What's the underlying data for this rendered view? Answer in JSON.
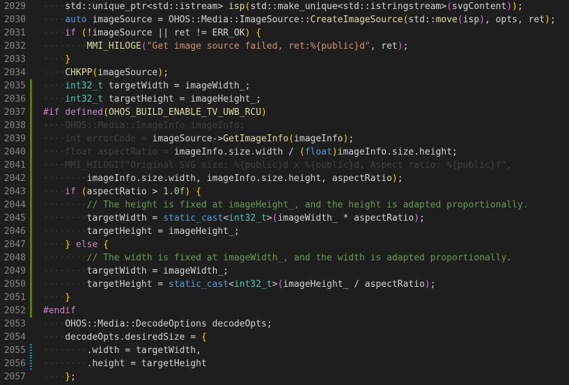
{
  "editor": {
    "lines": [
      {
        "number": "2029",
        "gutter": "",
        "tokens": [
          [
            "····",
            "ws"
          ],
          [
            "std::unique_ptr<std::istream>",
            "plain"
          ],
          [
            " ",
            "ws"
          ],
          [
            "isp",
            "fn"
          ],
          [
            "(",
            "b1"
          ],
          [
            "std::make_unique<std::istringstream>",
            "plain"
          ],
          [
            "(",
            "b2"
          ],
          [
            "svgContent",
            "plain"
          ],
          [
            ")",
            "b2"
          ],
          [
            ")",
            "b1"
          ],
          [
            ";",
            "plain"
          ]
        ]
      },
      {
        "number": "2030",
        "gutter": "",
        "tokens": [
          [
            "····",
            "ws"
          ],
          [
            "auto",
            "kw"
          ],
          [
            " imageSource = OHOS::Media::ImageSource::",
            "plain"
          ],
          [
            "CreateImageSource",
            "fn"
          ],
          [
            "(",
            "b1"
          ],
          [
            "std::",
            "plain"
          ],
          [
            "move",
            "fn"
          ],
          [
            "(",
            "b2"
          ],
          [
            "isp",
            "plain"
          ],
          [
            ")",
            "b2"
          ],
          [
            ", opts, ret",
            "plain"
          ],
          [
            ")",
            "b1"
          ],
          [
            ";",
            "plain"
          ]
        ]
      },
      {
        "number": "2031",
        "gutter": "",
        "tokens": [
          [
            "····",
            "ws"
          ],
          [
            "if",
            "ctl"
          ],
          [
            " ",
            "ws"
          ],
          [
            "(",
            "b1"
          ],
          [
            "!imageSource || ret != ERR_OK",
            "plain"
          ],
          [
            ")",
            "b1"
          ],
          [
            " ",
            "ws"
          ],
          [
            "{",
            "b1"
          ]
        ]
      },
      {
        "number": "2032",
        "gutter": "",
        "tokens": [
          [
            "····",
            "ws"
          ],
          [
            "····",
            "ws"
          ],
          [
            "MMI_HILOGE",
            "macro"
          ],
          [
            "(",
            "b2"
          ],
          [
            "\"Get image source failed, ret:%{public}d\"",
            "str"
          ],
          [
            ", ret",
            "plain"
          ],
          [
            ")",
            "b2"
          ],
          [
            ";",
            "plain"
          ]
        ]
      },
      {
        "number": "2033",
        "gutter": "",
        "tokens": [
          [
            "····",
            "ws"
          ],
          [
            "}",
            "b1"
          ]
        ]
      },
      {
        "number": "2034",
        "gutter": "",
        "tokens": [
          [
            "····",
            "ws"
          ],
          [
            "CHKPP",
            "macro"
          ],
          [
            "(",
            "b1"
          ],
          [
            "imageSource",
            "plain"
          ],
          [
            ")",
            "b1"
          ],
          [
            ";",
            "plain"
          ]
        ]
      },
      {
        "number": "2035",
        "gutter": "added",
        "tokens": [
          [
            "····",
            "ws"
          ],
          [
            "int32_t",
            "type"
          ],
          [
            " targetWidth = imageWidth_;",
            "plain"
          ]
        ]
      },
      {
        "number": "2036",
        "gutter": "added",
        "tokens": [
          [
            "····",
            "ws"
          ],
          [
            "int32_t",
            "type"
          ],
          [
            " targetHeight = imageHeight_;",
            "plain"
          ]
        ]
      },
      {
        "number": "2037",
        "gutter": "added",
        "tokens": [
          [
            "#if",
            "pp"
          ],
          [
            " ",
            "plain"
          ],
          [
            "defined",
            "pp"
          ],
          [
            "(",
            "b1"
          ],
          [
            "OHOS_BUILD_ENABLE_TV_UWB_RCU",
            "macro"
          ],
          [
            ")",
            "b1"
          ]
        ]
      },
      {
        "number": "2038",
        "gutter": "added",
        "tokens": [
          [
            "····OHOS::Media::ImageInfo imageInfo;",
            "guide"
          ]
        ]
      },
      {
        "number": "2039",
        "gutter": "added",
        "tokens": [
          [
            "····int errorCode = ",
            "guide"
          ],
          [
            "imageSource->",
            "plain"
          ],
          [
            "GetImageInfo",
            "fn"
          ],
          [
            "(",
            "b1"
          ],
          [
            "imageInfo",
            "plain"
          ],
          [
            ")",
            "b1"
          ],
          [
            ";",
            "plain"
          ]
        ]
      },
      {
        "number": "2040",
        "gutter": "added",
        "tokens": [
          [
            "····float aspectRatio = ",
            "guide"
          ],
          [
            "imageInfo.size.width / ",
            "plain"
          ],
          [
            "(",
            "b1"
          ],
          [
            "float",
            "kw"
          ],
          [
            ")",
            "b1"
          ],
          [
            "imageInfo.size.height;",
            "plain"
          ]
        ]
      },
      {
        "number": "2041",
        "gutter": "added",
        "tokens": [
          [
            "····MMI_HILOGI(\"Original SVG size: %{public}d x %{public}d, Aspect ratio: %{public}f\",",
            "guide"
          ]
        ]
      },
      {
        "number": "2042",
        "gutter": "added",
        "tokens": [
          [
            "········",
            "ws"
          ],
          [
            "imageInfo.size.width, imageInfo.size.height, aspectRatio",
            "plain"
          ],
          [
            ")",
            "b1"
          ],
          [
            ";",
            "plain"
          ]
        ]
      },
      {
        "number": "2043",
        "gutter": "added",
        "tokens": [
          [
            "····",
            "ws"
          ],
          [
            "if",
            "ctl"
          ],
          [
            " ",
            "ws"
          ],
          [
            "(",
            "b1"
          ],
          [
            "aspectRatio > ",
            "plain"
          ],
          [
            "1.0f",
            "num"
          ],
          [
            ")",
            "b1"
          ],
          [
            " ",
            "ws"
          ],
          [
            "{",
            "b1"
          ]
        ]
      },
      {
        "number": "2044",
        "gutter": "added",
        "tokens": [
          [
            "····",
            "ws"
          ],
          [
            "····",
            "ws"
          ],
          [
            "// The height is fixed at imageHeight_, and the height is adapted proportionally.",
            "cmt"
          ]
        ]
      },
      {
        "number": "2045",
        "gutter": "added",
        "tokens": [
          [
            "····",
            "ws"
          ],
          [
            "····",
            "ws"
          ],
          [
            "targetWidth = ",
            "plain"
          ],
          [
            "static_cast",
            "kw"
          ],
          [
            "<",
            "plain"
          ],
          [
            "int32_t",
            "type"
          ],
          [
            ">",
            "plain"
          ],
          [
            "(",
            "b2"
          ],
          [
            "imageWidth_ * aspectRatio",
            "plain"
          ],
          [
            ")",
            "b2"
          ],
          [
            ";",
            "plain"
          ]
        ]
      },
      {
        "number": "2046",
        "gutter": "added",
        "tokens": [
          [
            "····",
            "ws"
          ],
          [
            "····",
            "ws"
          ],
          [
            "targetHeight = imageHeight_;",
            "plain"
          ]
        ]
      },
      {
        "number": "2047",
        "gutter": "added",
        "tokens": [
          [
            "····",
            "ws"
          ],
          [
            "}",
            "b1"
          ],
          [
            " ",
            "ws"
          ],
          [
            "else",
            "ctl"
          ],
          [
            " ",
            "ws"
          ],
          [
            "{",
            "b1"
          ]
        ]
      },
      {
        "number": "2048",
        "gutter": "added",
        "tokens": [
          [
            "····",
            "ws"
          ],
          [
            "····",
            "ws"
          ],
          [
            "// The width is fixed at imageWidth_, and the width is adapted proportionally.",
            "cmt"
          ]
        ]
      },
      {
        "number": "2049",
        "gutter": "added",
        "tokens": [
          [
            "····",
            "ws"
          ],
          [
            "····",
            "ws"
          ],
          [
            "targetWidth = imageWidth_;",
            "plain"
          ]
        ]
      },
      {
        "number": "2050",
        "gutter": "added",
        "tokens": [
          [
            "····",
            "ws"
          ],
          [
            "····",
            "ws"
          ],
          [
            "targetHeight = ",
            "plain"
          ],
          [
            "static_cast",
            "kw"
          ],
          [
            "<",
            "plain"
          ],
          [
            "int32_t",
            "type"
          ],
          [
            ">",
            "plain"
          ],
          [
            "(",
            "b2"
          ],
          [
            "imageHeight_ / aspectRatio",
            "plain"
          ],
          [
            ")",
            "b2"
          ],
          [
            ";",
            "plain"
          ]
        ]
      },
      {
        "number": "2051",
        "gutter": "added",
        "tokens": [
          [
            "····",
            "ws"
          ],
          [
            "}",
            "b1"
          ]
        ]
      },
      {
        "number": "2052",
        "gutter": "added",
        "tokens": [
          [
            "#endif",
            "pp"
          ]
        ]
      },
      {
        "number": "2053",
        "gutter": "",
        "tokens": [
          [
            "····",
            "ws"
          ],
          [
            "OHOS::Media::DecodeOptions decodeOpts;",
            "plain"
          ]
        ]
      },
      {
        "number": "2054",
        "gutter": "",
        "tokens": [
          [
            "····",
            "ws"
          ],
          [
            "decodeOpts.desiredSize = ",
            "plain"
          ],
          [
            "{",
            "b1"
          ]
        ]
      },
      {
        "number": "2055",
        "gutter": "modified",
        "tokens": [
          [
            "····",
            "ws"
          ],
          [
            "····",
            "ws"
          ],
          [
            ".width = targetWidth,",
            "plain"
          ]
        ]
      },
      {
        "number": "2056",
        "gutter": "modified",
        "tokens": [
          [
            "····",
            "ws"
          ],
          [
            "····",
            "ws"
          ],
          [
            ".height = targetHeight",
            "plain"
          ]
        ]
      },
      {
        "number": "2057",
        "gutter": "",
        "tokens": [
          [
            "····",
            "ws"
          ],
          [
            "}",
            "b1"
          ],
          [
            ";",
            "plain"
          ]
        ]
      }
    ]
  }
}
